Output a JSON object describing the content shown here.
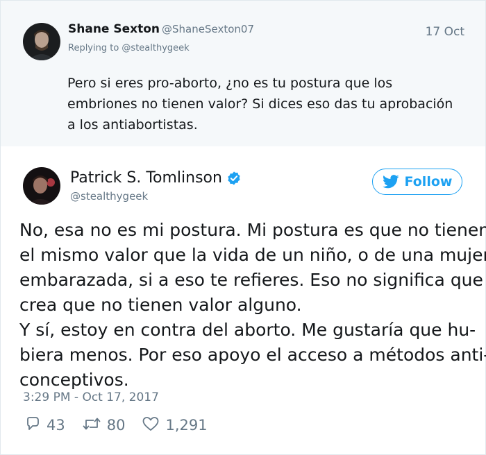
{
  "reply_tweet": {
    "author_name": "Shane Sexton",
    "author_handle": "@ShaneSexton07",
    "date": "17 Oct",
    "replying_to": "Replying to @stealthygeek",
    "text": "Pero si eres pro-aborto, ¿no es tu postura que los embriones no tienen valor? Si dices eso das tu aprobación a los antiabortistas."
  },
  "main_tweet": {
    "author_name": "Patrick S. Tomlinson",
    "author_handle": "@stealthygeek",
    "follow_label": "Follow",
    "text_lines": [
      "No, esa no es mi postura. Mi postura es que no tienen",
      "el mismo valor que la vida de un niño, o de una mujer",
      "embarazada, si a eso te refieres. Eso no significa que",
      "crea que no tienen valor alguno.",
      "Y sí, estoy en contra del aborto. Me gustaría que hu-",
      "biera menos. Por eso apoyo el acceso a métodos anti-",
      "conceptivos."
    ],
    "timestamp": "3:29 PM - Oct 17, 2017",
    "replies": "43",
    "retweets": "80",
    "likes": "1,291"
  },
  "colors": {
    "twitter_blue": "#1da1f2",
    "secondary_text": "#657786",
    "reply_background": "#f5f8fa"
  },
  "icons": [
    "verified-badge-icon",
    "twitter-bird-icon",
    "reply-icon",
    "retweet-icon",
    "heart-icon"
  ]
}
